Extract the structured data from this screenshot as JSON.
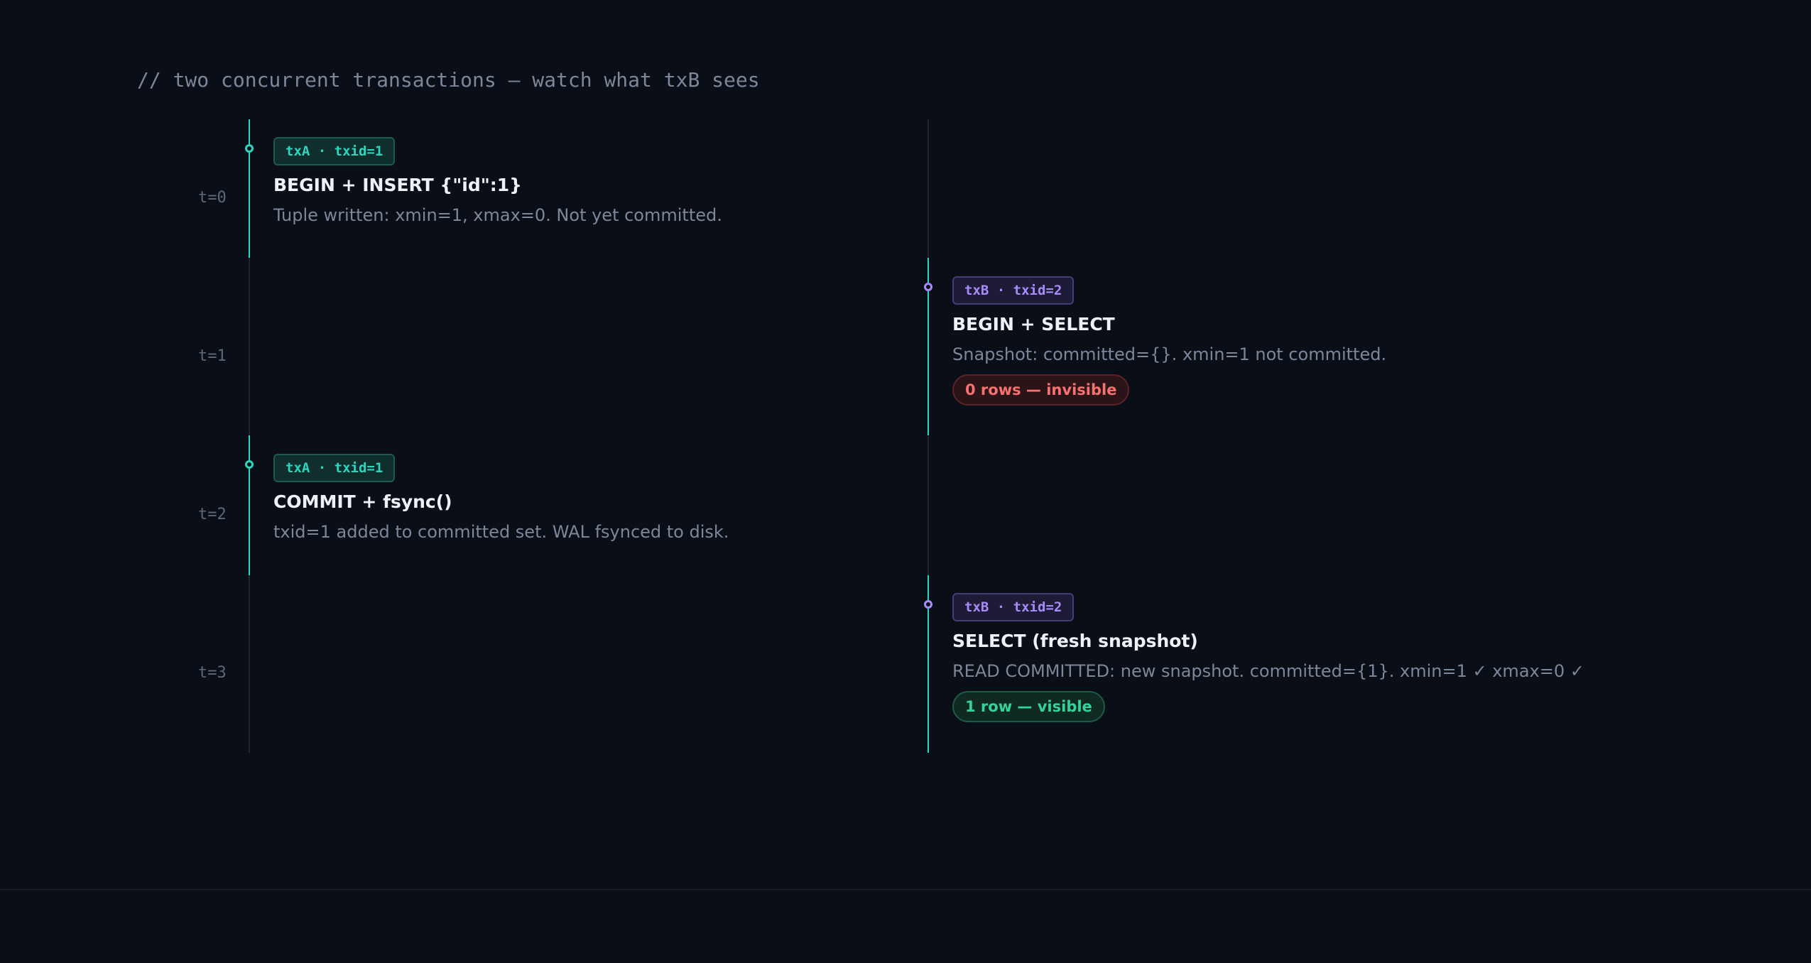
{
  "heading": "// two concurrent transactions — watch what txB sees",
  "time_labels": [
    "t=0",
    "t=1",
    "t=2",
    "t=3"
  ],
  "events": [
    {
      "time": "t=0",
      "lane": "txA",
      "tag": "txA · txid=1",
      "title": "BEGIN + INSERT {\"id\":1}",
      "description": "Tuple written: xmin=1, xmax=0. Not yet committed."
    },
    {
      "time": "t=1",
      "lane": "txB",
      "tag": "txB · txid=2",
      "title": "BEGIN + SELECT",
      "description": "Snapshot: committed={}. xmin=1 not committed.",
      "result": "0 rows — invisible"
    },
    {
      "time": "t=2",
      "lane": "txA",
      "tag": "txA · txid=1",
      "title": "COMMIT + fsync()",
      "description": "txid=1 added to committed set. WAL fsynced to disk."
    },
    {
      "time": "t=3",
      "lane": "txB",
      "tag": "txB · txid=2",
      "title": "SELECT (fresh snapshot)",
      "description": "READ COMMITTED: new snapshot. committed={1}. xmin=1 ✓ xmax=0 ✓",
      "result": "1 row — visible"
    }
  ],
  "colors": {
    "background": "#0a0e17",
    "txA_accent": "#2dd4bf",
    "txB_accent": "#a78bfa",
    "invisible": "#f87171",
    "visible": "#34d399"
  }
}
